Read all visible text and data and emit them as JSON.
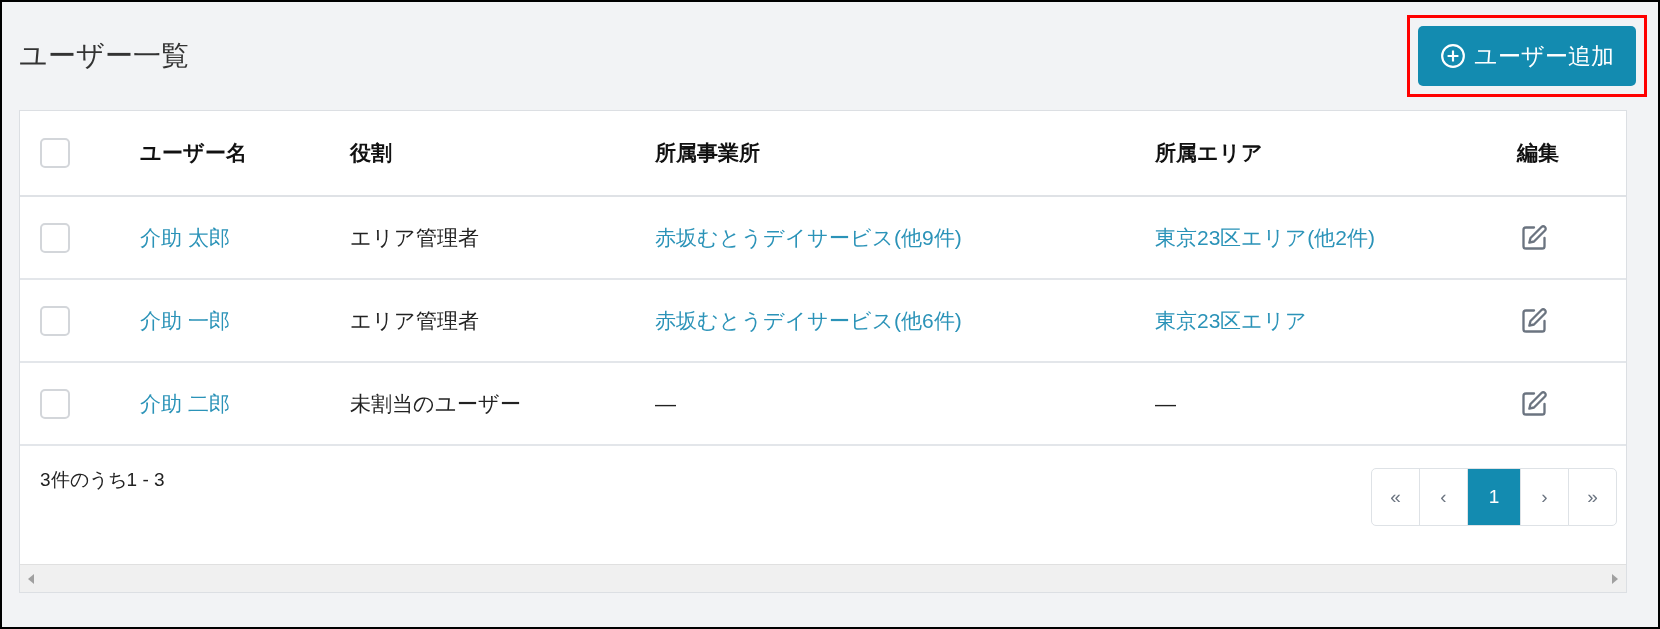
{
  "title": "ユーザー一覧",
  "add_button": {
    "label": "ユーザー追加",
    "highlighted": true
  },
  "table": {
    "select_all": {
      "checked": false
    },
    "columns": [
      "ユーザー名",
      "役割",
      "所属事業所",
      "所属エリア",
      "編集"
    ],
    "rows": [
      {
        "checked": false,
        "name": "介助 太郎",
        "role": "エリア管理者",
        "office": "赤坂むとうデイサービス(他9件)",
        "office_link": true,
        "area": "東京23区エリア(他2件)",
        "area_link": true
      },
      {
        "checked": false,
        "name": "介助 一郎",
        "role": "エリア管理者",
        "office": "赤坂むとうデイサービス(他6件)",
        "office_link": true,
        "area": "東京23区エリア",
        "area_link": true
      },
      {
        "checked": false,
        "name": "介助 二郎",
        "role": "未割当のユーザー",
        "office": "—",
        "office_link": false,
        "area": "—",
        "area_link": false
      }
    ]
  },
  "summary": "3件のうち1 - 3",
  "pagination": [
    {
      "label": "«",
      "selected": false
    },
    {
      "label": "‹",
      "selected": false
    },
    {
      "label": "1",
      "selected": true
    },
    {
      "label": "›",
      "selected": false
    },
    {
      "label": "»",
      "selected": false
    }
  ]
}
